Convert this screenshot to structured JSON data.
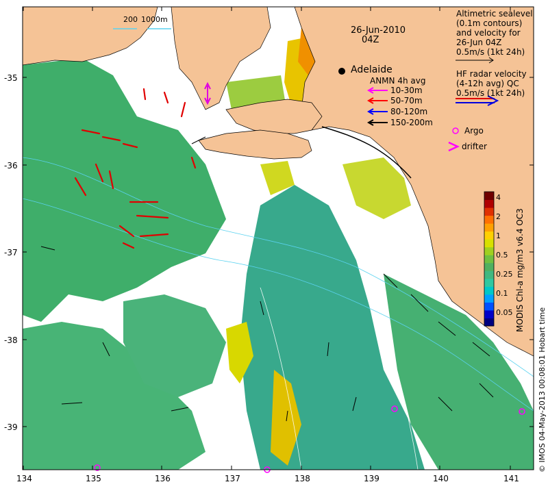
{
  "title": {
    "date": "26-Jun-2010",
    "time": "04Z"
  },
  "scale_bar": {
    "labels": [
      "200",
      "1000m"
    ]
  },
  "axes": {
    "x_ticks": [
      "134",
      "135",
      "136",
      "137",
      "138",
      "139",
      "140",
      "141"
    ],
    "y_ticks": [
      "-35",
      "-36",
      "-37",
      "-38",
      "-39"
    ]
  },
  "place_labels": {
    "adelaide": "Adelaide"
  },
  "legend_altimetry": {
    "lines": [
      "Altimetric sealevel",
      "(0.1m contours)",
      "and velocity for",
      "26-Jun 04Z",
      "0.5m/s (1kt 24h)"
    ]
  },
  "legend_hf_radar": {
    "lines": [
      "HF radar velocity",
      "(4-12h avg) QC",
      "0.5m/s (1kt 24h)"
    ]
  },
  "legend_anmn": {
    "title": "ANMN 4h avg",
    "items": [
      {
        "label": "10-30m",
        "color": "#ff00ff"
      },
      {
        "label": "50-70m",
        "color": "#ff0000"
      },
      {
        "label": "80-120m",
        "color": "#0000ff"
      },
      {
        "label": "150-200m",
        "color": "#000000"
      }
    ]
  },
  "legend_markers": {
    "argo": "Argo",
    "drifter": "drifter",
    "marker_color": "#ff00ff"
  },
  "colorbar": {
    "title": "MODIS Chl-a mg/m3 v6.4 OC3",
    "tick_labels": [
      "4",
      "2",
      "1",
      "0.5",
      "0.25",
      "0.1",
      "0.05"
    ],
    "colors": [
      "#000080",
      "#0000c8",
      "#0050ff",
      "#00a0ff",
      "#00c8c8",
      "#30c8a0",
      "#40b880",
      "#50b060",
      "#70c040",
      "#a0d020",
      "#d8e000",
      "#ffd000",
      "#ffa000",
      "#ff7000",
      "#e03000",
      "#b00000",
      "#700000"
    ]
  },
  "credit": "© IMOS 04-May-2013 00:08:01 Hobart time",
  "colors": {
    "land": "#f5c396",
    "water_blank": "#ffffff",
    "chl_mid": "#40b47c",
    "chl_high": "#e0d000"
  }
}
